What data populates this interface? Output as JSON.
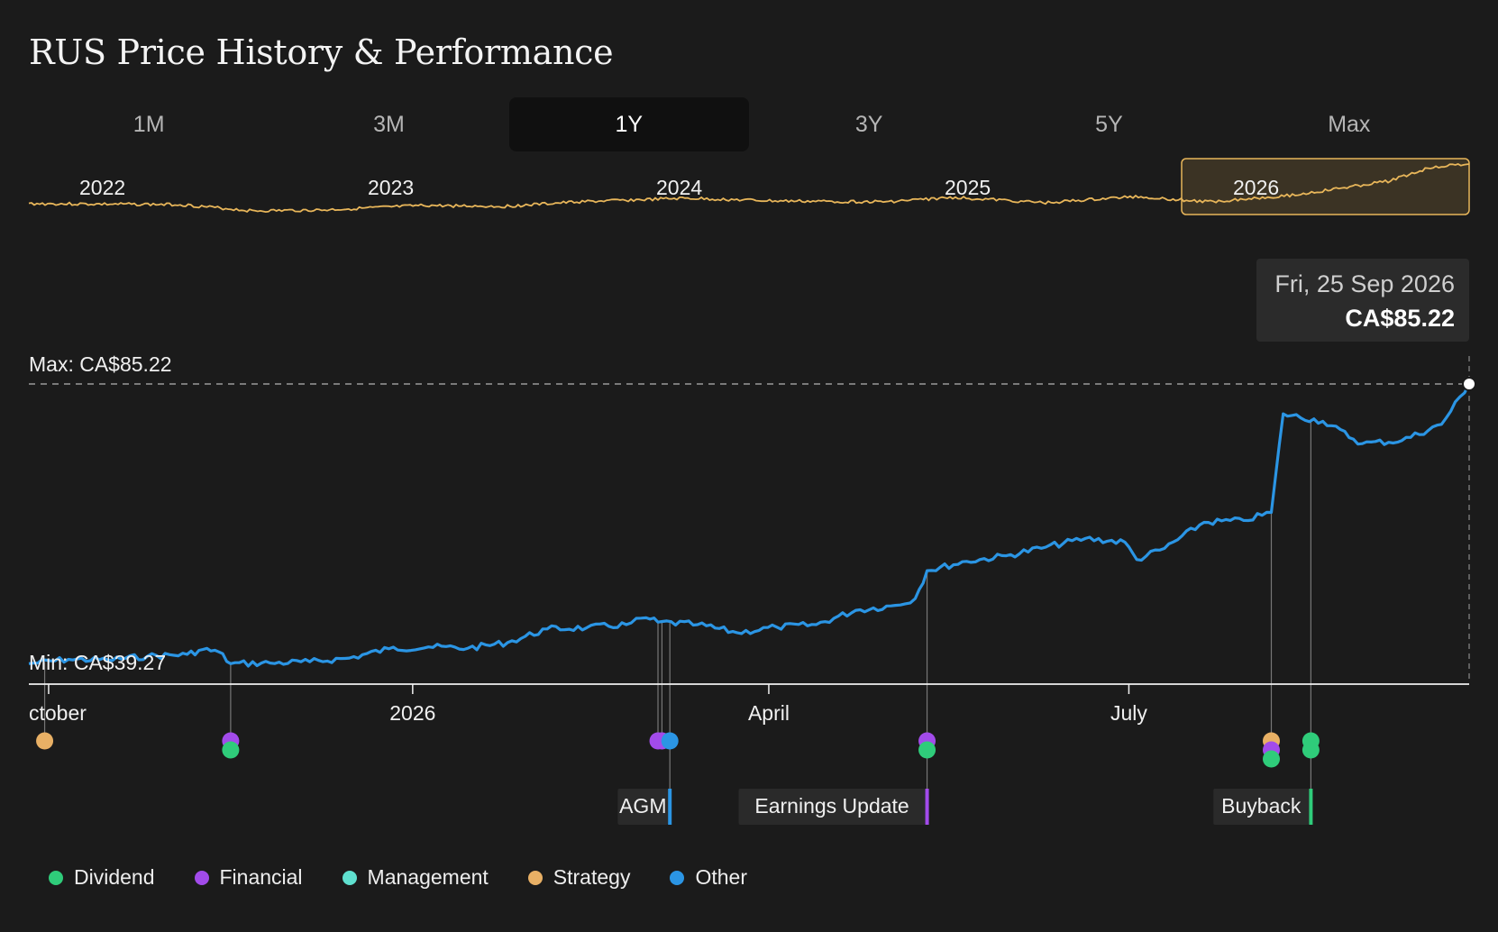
{
  "title": "RUS Price History & Performance",
  "tabs": [
    {
      "label": "1M",
      "active": false
    },
    {
      "label": "3M",
      "active": false
    },
    {
      "label": "1Y",
      "active": true
    },
    {
      "label": "3Y",
      "active": false
    },
    {
      "label": "5Y",
      "active": false
    },
    {
      "label": "Max",
      "active": false
    }
  ],
  "navigator": {
    "year_labels": [
      "2022",
      "2023",
      "2024",
      "2025",
      "2026"
    ],
    "line_color": "#e8b65a",
    "selection_color": "#e8b65a"
  },
  "tooltip": {
    "date": "Fri, 25 Sep 2026",
    "price": "CA$85.22"
  },
  "max_label": "Max: CA$85.22",
  "min_label": "Min: CA$39.27",
  "colors": {
    "line": "#2b95e4",
    "dividend": "#2fcc7a",
    "financial": "#a24bea",
    "management": "#5fe0cf",
    "strategy": "#e8b065",
    "other": "#2b95e4"
  },
  "chart_data": {
    "type": "line",
    "title": "RUS Price History & Performance",
    "xlabel": "",
    "ylabel": "",
    "x_ticks": [
      "ctober",
      "2026",
      "April",
      "July"
    ],
    "ylim": [
      39.27,
      85.22
    ],
    "grid": false,
    "legend_placement": "bottom-left",
    "series": [
      {
        "points": [
          [
            "2025-09-26",
            40.1
          ],
          [
            "2025-10-06",
            40.8
          ],
          [
            "2025-10-16",
            40.7
          ],
          [
            "2025-10-26",
            41.3
          ],
          [
            "2025-11-05",
            41.6
          ],
          [
            "2025-11-09",
            42.4
          ],
          [
            "2025-11-13",
            42.0
          ],
          [
            "2025-11-16",
            40.1
          ],
          [
            "2025-11-26",
            40.2
          ],
          [
            "2025-12-06",
            40.4
          ],
          [
            "2025-12-16",
            41.0
          ],
          [
            "2025-12-26",
            42.5
          ],
          [
            "2026-01-05",
            42.8
          ],
          [
            "2026-01-15",
            42.6
          ],
          [
            "2026-01-25",
            43.5
          ],
          [
            "2026-02-04",
            45.7
          ],
          [
            "2026-02-14",
            45.9
          ],
          [
            "2026-02-24",
            46.4
          ],
          [
            "2026-03-01",
            47.5
          ],
          [
            "2026-03-04",
            46.8
          ],
          [
            "2026-03-14",
            46.4
          ],
          [
            "2026-03-24",
            45.1
          ],
          [
            "2026-04-03",
            46.0
          ],
          [
            "2026-04-13",
            46.4
          ],
          [
            "2026-04-23",
            48.7
          ],
          [
            "2026-05-03",
            49.5
          ],
          [
            "2026-05-08",
            50.6
          ],
          [
            "2026-05-11",
            55.1
          ],
          [
            "2026-05-21",
            56.6
          ],
          [
            "2026-05-31",
            57.5
          ],
          [
            "2026-06-10",
            58.9
          ],
          [
            "2026-06-20",
            60.3
          ],
          [
            "2026-06-30",
            59.7
          ],
          [
            "2026-07-03",
            56.9
          ],
          [
            "2026-07-10",
            58.7
          ],
          [
            "2026-07-20",
            62.9
          ],
          [
            "2026-07-30",
            63.2
          ],
          [
            "2026-08-06",
            64.5
          ],
          [
            "2026-08-09",
            80.4
          ],
          [
            "2026-08-19",
            79.2
          ],
          [
            "2026-08-29",
            75.6
          ],
          [
            "2026-09-08",
            76.1
          ],
          [
            "2026-09-18",
            78.7
          ],
          [
            "2026-09-25",
            85.22
          ]
        ]
      }
    ],
    "events": [
      {
        "date": "2025-09-30",
        "type": "Strategy"
      },
      {
        "date": "2025-11-16",
        "type": "Financial"
      },
      {
        "date": "2025-11-16",
        "type": "Dividend"
      },
      {
        "date": "2026-03-04",
        "type": "Financial"
      },
      {
        "date": "2026-03-05",
        "type": "Financial"
      },
      {
        "date": "2026-03-07",
        "type": "Other",
        "label": "AGM"
      },
      {
        "date": "2026-05-11",
        "type": "Financial",
        "label": "Earnings Update"
      },
      {
        "date": "2026-05-11",
        "type": "Dividend"
      },
      {
        "date": "2026-08-06",
        "type": "Strategy"
      },
      {
        "date": "2026-08-06",
        "type": "Financial"
      },
      {
        "date": "2026-08-06",
        "type": "Dividend"
      },
      {
        "date": "2026-08-16",
        "type": "Dividend",
        "label": "Buyback"
      },
      {
        "date": "2026-08-16",
        "type": "Dividend"
      }
    ],
    "legend": [
      "Dividend",
      "Financial",
      "Management",
      "Strategy",
      "Other"
    ]
  }
}
